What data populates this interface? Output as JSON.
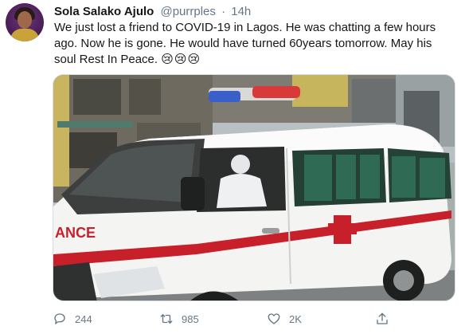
{
  "user": {
    "display_name": "Sola Salako Ajulo",
    "handle": "@purrples",
    "separator": "·",
    "time": "14h"
  },
  "tweet": {
    "text": "We just lost a friend to COVID-19 in Lagos. He was chatting a few hours ago. Now he is gone. He would have turned 60years tomorrow. May his soul Rest In Peace.",
    "emojis": "😢😢😢"
  },
  "media": {
    "ambulance_text": "ANCE"
  },
  "actions": {
    "replies": "244",
    "retweets": "985",
    "likes": "2K"
  },
  "icons": {
    "reply": "reply-icon",
    "retweet": "retweet-icon",
    "like": "heart-icon",
    "share": "share-icon"
  },
  "colors": {
    "text": "#14171a",
    "secondary": "#657786",
    "ambulance_stripe": "#c8202a"
  }
}
